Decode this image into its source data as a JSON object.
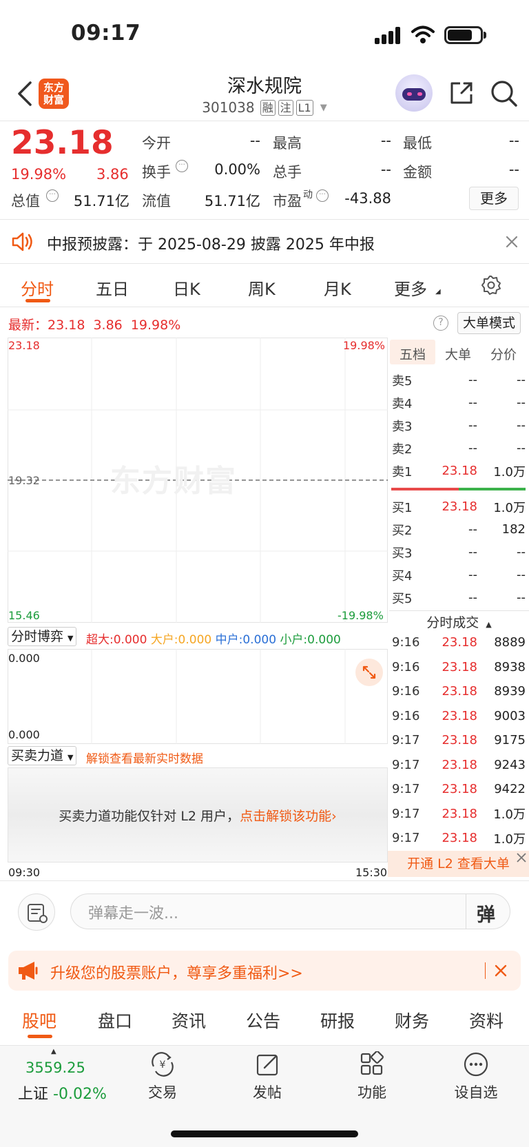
{
  "status_bar": {
    "time": "09:17"
  },
  "header": {
    "logo_text_line1": "东方",
    "logo_text_line2": "财富",
    "stock_name": "深水规院",
    "stock_code": "301038",
    "tags": [
      "融",
      "注",
      "L1"
    ]
  },
  "quote": {
    "last_price": "23.18",
    "change_pct": "19.98%",
    "change": "3.86",
    "fields": [
      {
        "label": "今开",
        "value": "--"
      },
      {
        "label": "最高",
        "value": "--"
      },
      {
        "label": "最低",
        "value": "--"
      },
      {
        "label": "换手",
        "value": "0.00%"
      },
      {
        "label": "总手",
        "value": "--"
      },
      {
        "label": "金额",
        "value": "--"
      },
      {
        "label": "总值",
        "value": "51.71亿"
      },
      {
        "label": "流值",
        "value": "51.71亿"
      },
      {
        "label": "市盈",
        "sup": "动",
        "value": "-43.88"
      }
    ],
    "more_label": "更多"
  },
  "notice": {
    "text": "中报预披露：于 2025-08-29 披露 2025 年中报"
  },
  "chart_tabs": [
    "分时",
    "五日",
    "日K",
    "周K",
    "月K",
    "更多"
  ],
  "chart_info": {
    "latest_label": "最新：",
    "latest_price": "23.18",
    "latest_change": "3.86",
    "latest_pct": "19.98%",
    "mode_button": "大单模式"
  },
  "intraday_chart": {
    "price_top": "23.18",
    "price_mid": "19.32",
    "price_bottom": "15.46",
    "pct_top": "19.98%",
    "pct_bottom": "-19.98%",
    "watermark": "东方财富",
    "time_start": "09:30",
    "time_end": "15:30"
  },
  "game_section": {
    "dropdown": "分时博弈",
    "super_label": "超大:",
    "super_value": "0.000",
    "large_label": "大户:",
    "large_value": "0.000",
    "mid_label": "中户:",
    "mid_value": "0.000",
    "small_label": "小户:",
    "small_value": "0.000",
    "axis_top": "0.000",
    "axis_bottom": "0.000"
  },
  "force_section": {
    "dropdown": "买卖力道",
    "unlock_hint": "解锁查看最新实时数据",
    "l2_msg": "买卖力道功能仅针对 L2 用户，",
    "l2_link": "点击解锁该功能"
  },
  "order_book": {
    "tabs": [
      "五档",
      "大单",
      "分价"
    ],
    "sells": [
      {
        "label": "卖5",
        "price": "--",
        "vol": "--"
      },
      {
        "label": "卖4",
        "price": "--",
        "vol": "--"
      },
      {
        "label": "卖3",
        "price": "--",
        "vol": "--"
      },
      {
        "label": "卖2",
        "price": "--",
        "vol": "--"
      },
      {
        "label": "卖1",
        "price": "23.18",
        "vol": "1.0万"
      }
    ],
    "buys": [
      {
        "label": "买1",
        "price": "23.18",
        "vol": "1.0万"
      },
      {
        "label": "买2",
        "price": "--",
        "vol": "182"
      },
      {
        "label": "买3",
        "price": "--",
        "vol": "--"
      },
      {
        "label": "买4",
        "price": "--",
        "vol": "--"
      },
      {
        "label": "买5",
        "price": "--",
        "vol": "--"
      }
    ],
    "buy_sell_ratio": 0.5
  },
  "trades": {
    "title": "分时成交",
    "rows": [
      {
        "time": "9:16",
        "price": "23.18",
        "vol": "8889"
      },
      {
        "time": "9:16",
        "price": "23.18",
        "vol": "8938"
      },
      {
        "time": "9:16",
        "price": "23.18",
        "vol": "8939"
      },
      {
        "time": "9:16",
        "price": "23.18",
        "vol": "9003"
      },
      {
        "time": "9:17",
        "price": "23.18",
        "vol": "9175"
      },
      {
        "time": "9:17",
        "price": "23.18",
        "vol": "9243"
      },
      {
        "time": "9:17",
        "price": "23.18",
        "vol": "9422"
      },
      {
        "time": "9:17",
        "price": "23.18",
        "vol": "1.0万"
      },
      {
        "time": "9:17",
        "price": "23.18",
        "vol": "1.0万"
      }
    ],
    "l2_banner": "开通 L2 查看大单"
  },
  "comment": {
    "placeholder": "弹幕走一波...",
    "danmu_label": "弹"
  },
  "promo": {
    "text": "升级您的股票账户，尊享多重福利>>"
  },
  "bottom_tabs": [
    "股吧",
    "盘口",
    "资讯",
    "公告",
    "研报",
    "财务",
    "资料"
  ],
  "toolbar": {
    "index_value": "3559.25",
    "index_name": "上证",
    "index_change": "-0.02%",
    "items": [
      "交易",
      "发帖",
      "功能",
      "设自选"
    ]
  },
  "colors": {
    "accent": "#f05a14",
    "up": "#e62e2e",
    "down": "#1c9c3c"
  }
}
